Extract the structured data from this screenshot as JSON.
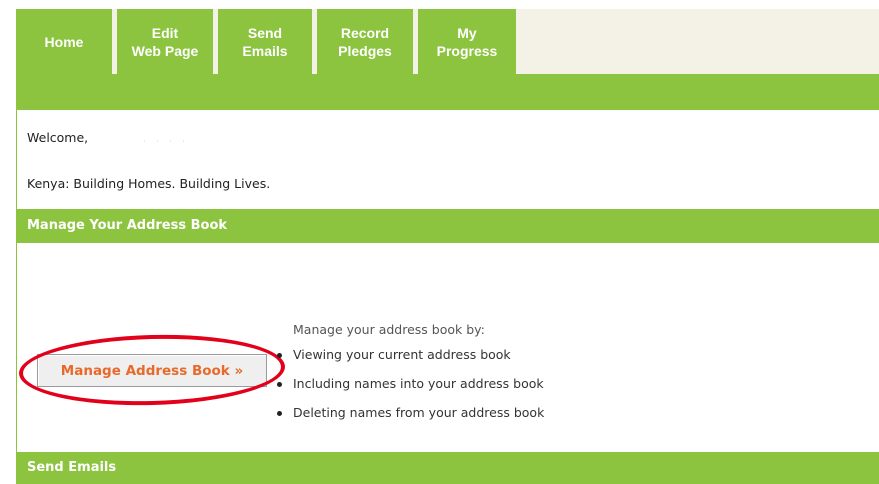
{
  "nav": {
    "tabs": [
      {
        "line1": "Home",
        "line2": ""
      },
      {
        "line1": "Edit",
        "line2": "Web Page"
      },
      {
        "line1": "Send",
        "line2": "Emails"
      },
      {
        "line1": "Record",
        "line2": "Pledges"
      },
      {
        "line1": "My",
        "line2": "Progress"
      }
    ]
  },
  "welcome": {
    "label": "Welcome,",
    "redacted_name": "· · · ·"
  },
  "tagline": "Kenya: Building Homes. Building Lives.",
  "address_book": {
    "section_title": "Manage Your Address Book",
    "button_label": "Manage Address Book »",
    "intro": "Manage your address book by:",
    "items": [
      "Viewing your current address book",
      "Including names into your address book",
      "Deleting names from your address book"
    ]
  },
  "send_emails": {
    "section_title": "Send Emails"
  },
  "colors": {
    "brand_green": "#8cc43f",
    "nav_strip": "#f4f1e6",
    "button_text": "#e8692a",
    "highlight_circle": "#e3001b"
  }
}
